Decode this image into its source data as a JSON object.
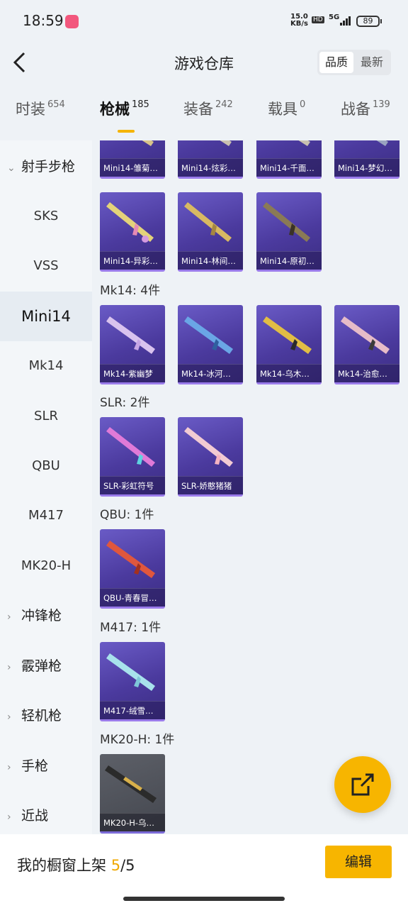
{
  "status_bar": {
    "time": "18:59",
    "net_speed_value": "15.0",
    "net_speed_unit": "KB/s",
    "hd_label": "HD",
    "signal_label": "5G",
    "battery": "89"
  },
  "header": {
    "title": "游戏仓库",
    "sort_options": [
      "品质",
      "最新"
    ]
  },
  "tabs": [
    {
      "label": "时装",
      "count": "654"
    },
    {
      "label": "枪械",
      "count": "185"
    },
    {
      "label": "装备",
      "count": "242"
    },
    {
      "label": "载具",
      "count": "0"
    },
    {
      "label": "战备",
      "count": "139"
    }
  ],
  "sidebar": {
    "category_open": "射手步枪",
    "items": [
      "SKS",
      "VSS",
      "Mini14",
      "Mk14",
      "SLR",
      "QBU",
      "M417",
      "MK20-H"
    ],
    "categories_closed": [
      "冲锋枪",
      "霰弹枪",
      "轻机枪",
      "手枪",
      "近战"
    ]
  },
  "content": {
    "top_row": [
      "Mini14-雏菊…",
      "Mini14-炫彩…",
      "Mini14-千面…",
      "Mini14-梦幻…"
    ],
    "mini14_row2": [
      "Mini14-异彩…",
      "Mini14-林间…",
      "Mini14-原初…"
    ],
    "sections": [
      {
        "label": "Mk14: 4件",
        "items": [
          "Mk14-紫幽梦",
          "Mk14-冰河…",
          "Mk14-乌木…",
          "Mk14-治愈…"
        ]
      },
      {
        "label": "SLR: 2件",
        "items": [
          "SLR-彩虹符号",
          "SLR-娇憨猪猪"
        ]
      },
      {
        "label": "QBU: 1件",
        "items": [
          "QBU-青春冒…"
        ]
      },
      {
        "label": "M417: 1件",
        "items": [
          "M417-绒雪…"
        ]
      },
      {
        "label": "MK20-H: 1件",
        "items": [
          "MK20-H-乌…"
        ]
      }
    ]
  },
  "bottom_bar": {
    "shelf_label": "我的橱窗上架",
    "shelf_current": "5",
    "shelf_total": "/5",
    "edit_label": "编辑"
  },
  "colors": {
    "accent": "#f7b500",
    "card_purple": "#4b3a9e"
  }
}
